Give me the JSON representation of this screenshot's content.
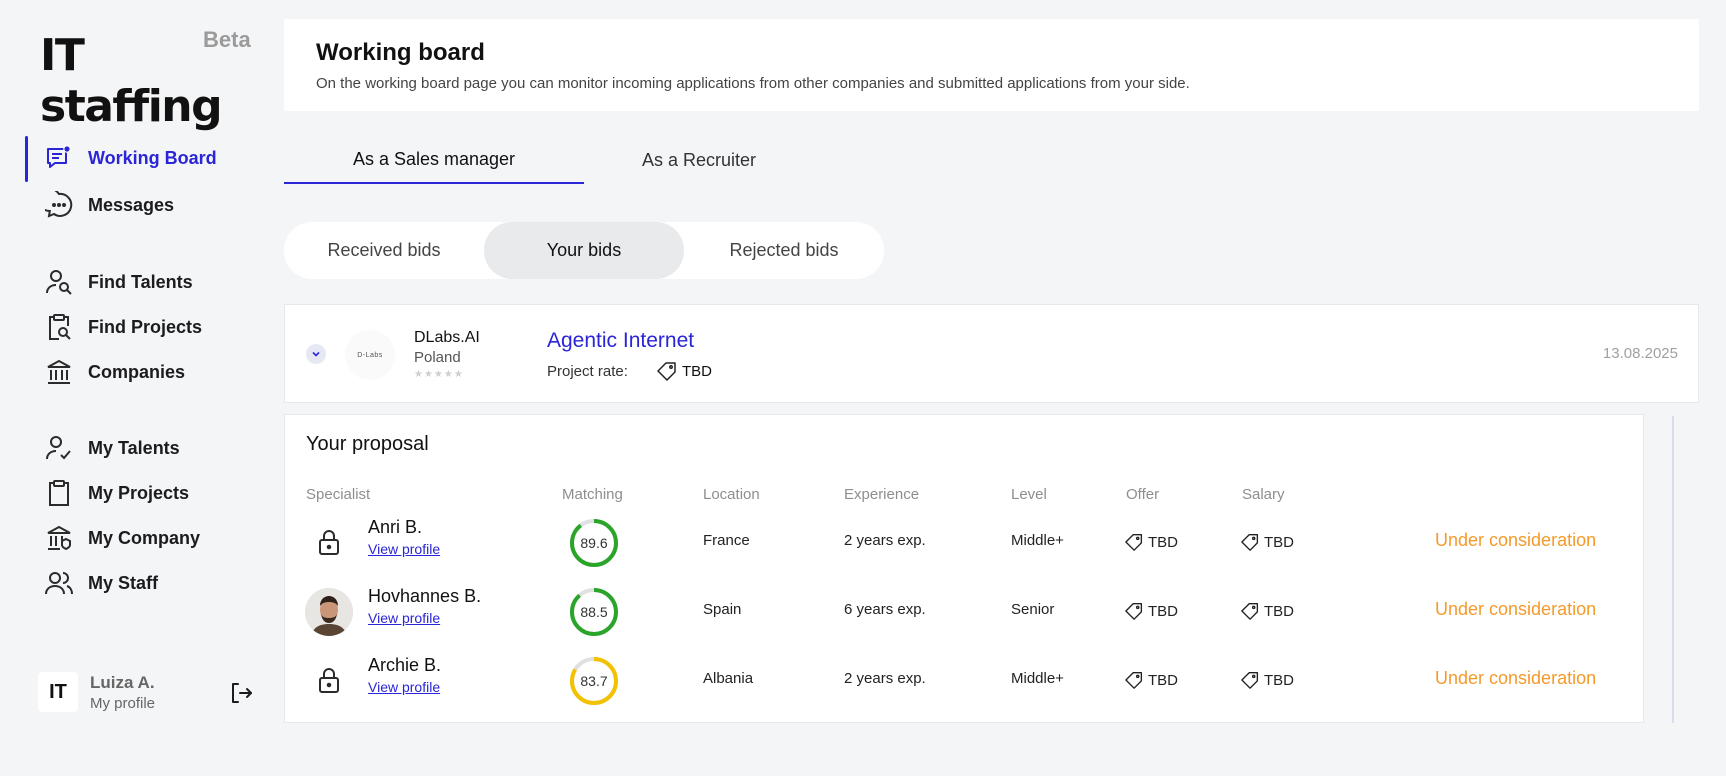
{
  "brand": {
    "name": "IT staffing",
    "badge": "Beta"
  },
  "sidebar": {
    "items": [
      {
        "label": "Working Board",
        "icon": "working-board-icon",
        "active": true
      },
      {
        "label": "Messages",
        "icon": "messages-icon"
      },
      {
        "label": "Find Talents",
        "icon": "find-talents-icon"
      },
      {
        "label": "Find Projects",
        "icon": "find-projects-icon"
      },
      {
        "label": "Companies",
        "icon": "companies-icon"
      },
      {
        "label": "My Talents",
        "icon": "my-talents-icon"
      },
      {
        "label": "My Projects",
        "icon": "my-projects-icon"
      },
      {
        "label": "My Company",
        "icon": "my-company-icon"
      },
      {
        "label": "My Staff",
        "icon": "my-staff-icon"
      }
    ],
    "profile": {
      "initials": "IT",
      "name": "Luiza A.",
      "link": "My profile"
    }
  },
  "header": {
    "title": "Working board",
    "subtitle": "On the working board page you can monitor incoming applications from other companies and submitted applications from your side."
  },
  "role_tabs": [
    {
      "label": "As a Sales manager",
      "selected": true
    },
    {
      "label": "As a Recruiter",
      "selected": false
    }
  ],
  "bid_tabs": [
    {
      "label": "Received bids",
      "selected": false
    },
    {
      "label": "Your bids",
      "selected": true
    },
    {
      "label": "Rejected bids",
      "selected": false
    }
  ],
  "bid": {
    "company_logo_text": "D-Labs",
    "company": "DLabs.AI",
    "country": "Poland",
    "rating": 0,
    "rating_max": 5,
    "project": "Agentic Internet",
    "rate_label": "Project rate:",
    "rate_value": "TBD",
    "date": "13.08.2025"
  },
  "proposal": {
    "title": "Your proposal",
    "columns": [
      "Specialist",
      "Matching",
      "Location",
      "Experience",
      "Level",
      "Offer",
      "Salary"
    ],
    "view_profile_label": "View profile",
    "rows": [
      {
        "name": "Anri B.",
        "photo": false,
        "matching": "89.6",
        "matching_color": "#2aa52a",
        "location": "France",
        "experience": "2 years exp.",
        "level": "Middle+",
        "offer": "TBD",
        "salary": "TBD",
        "status": "Under consideration"
      },
      {
        "name": "Hovhannes B.",
        "photo": true,
        "matching": "88.5",
        "matching_color": "#2aa52a",
        "location": "Spain",
        "experience": "6 years exp.",
        "level": "Senior",
        "offer": "TBD",
        "salary": "TBD",
        "status": "Under consideration"
      },
      {
        "name": "Archie B.",
        "photo": false,
        "matching": "83.7",
        "matching_color": "#f2c200",
        "location": "Albania",
        "experience": "2 years exp.",
        "level": "Middle+",
        "offer": "TBD",
        "salary": "TBD",
        "status": "Under consideration"
      }
    ]
  },
  "colors": {
    "accent": "#2a25d6",
    "status": "#f59a2a",
    "background": "#f4f5f7"
  }
}
